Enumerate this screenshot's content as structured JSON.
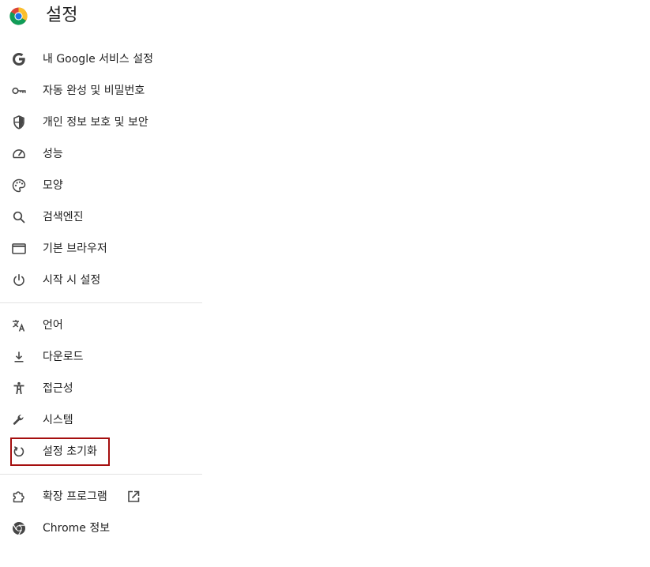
{
  "header": {
    "title": "설정",
    "logo": "chrome-logo"
  },
  "colors": {
    "icon": "#474747",
    "text": "#1f1f1f",
    "separator": "#e3e3e3",
    "highlight_border": "#a50e0e"
  },
  "nav": {
    "group1": [
      {
        "label": "내 Google 서비스 설정",
        "icon": "google-g-icon"
      },
      {
        "label": "자동 완성 및 비밀번호",
        "icon": "key-icon"
      },
      {
        "label": "개인 정보 보호 및 보안",
        "icon": "shield-icon"
      },
      {
        "label": "성능",
        "icon": "speedometer-icon"
      },
      {
        "label": "모양",
        "icon": "palette-icon"
      },
      {
        "label": "검색엔진",
        "icon": "search-icon"
      },
      {
        "label": "기본 브라우저",
        "icon": "browser-window-icon"
      },
      {
        "label": "시작 시 설정",
        "icon": "power-icon"
      }
    ],
    "group2": [
      {
        "label": "언어",
        "icon": "translate-icon"
      },
      {
        "label": "다운로드",
        "icon": "download-icon"
      },
      {
        "label": "접근성",
        "icon": "accessibility-icon"
      },
      {
        "label": "시스템",
        "icon": "wrench-icon"
      },
      {
        "label": "설정 초기화",
        "icon": "reset-icon"
      }
    ],
    "group3": [
      {
        "label": "확장 프로그램",
        "icon": "puzzle-icon",
        "extra_icon": "open-in-new-icon"
      },
      {
        "label": "Chrome 정보",
        "icon": "chrome-icon"
      }
    ]
  }
}
